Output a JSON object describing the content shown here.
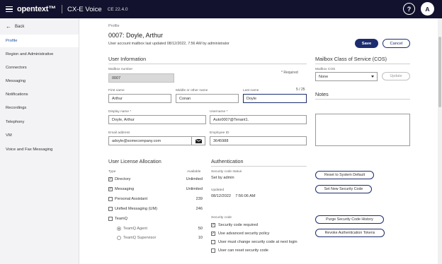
{
  "topbar": {
    "logo": "opentext™",
    "product": "CX-E Voice",
    "version": "CE 22.4.0",
    "help": "?",
    "avatar": "A"
  },
  "sidebar": {
    "back": "Back",
    "items": [
      {
        "label": "Profile",
        "active": true
      },
      {
        "label": "Region and Administrative"
      },
      {
        "label": "Connectors"
      },
      {
        "label": "Messaging"
      },
      {
        "label": "Notifications"
      },
      {
        "label": "Recordings"
      },
      {
        "label": "Telephony"
      },
      {
        "label": "VM"
      },
      {
        "label": "Voice and Fax Messaging"
      }
    ]
  },
  "header": {
    "breadcrumb": "Profile",
    "title": "0007: Doyle, Arthur",
    "subtitle": "User account mailbox last updated 08/12/2022, 7:56 AM by administrator",
    "save": "Save",
    "cancel": "Cancel"
  },
  "user_info": {
    "heading": "User Information",
    "required": "* Required",
    "mailbox_label": "Mailbox number",
    "mailbox_value": "0007",
    "first_name_label": "First name",
    "first_name": "Arthur",
    "middle_label": "Middle or other name",
    "middle_name": "Conan",
    "last_label": "Last name",
    "last_name": "Doyle",
    "last_counter": "5 / 25",
    "display_label": "Display name *",
    "display_name": "Doyle, Arthur",
    "username_label": "Username *",
    "username": "Auto0007@Tenant1.",
    "email_label": "Email address",
    "email": "adoyle@somecompany.com",
    "employee_label": "Employee ID",
    "employee_id": "3645988"
  },
  "cos": {
    "heading": "Mailbox Class of Service (COS)",
    "label": "Mailbox COS",
    "value": "None",
    "update": "Update"
  },
  "notes": {
    "heading": "Notes"
  },
  "license": {
    "heading": "User License Allocation",
    "col_type": "Type",
    "col_available": "Available",
    "rows": [
      {
        "label": "Directory",
        "available": "Unlimited",
        "checked": true
      },
      {
        "label": "Messaging",
        "available": "Unlimited",
        "checked": true
      },
      {
        "label": "Personal Assistant",
        "available": "239",
        "checked": false
      },
      {
        "label": "Unified Messaging (UM)",
        "available": "246",
        "checked": false
      },
      {
        "label": "TeamQ",
        "available": "",
        "checked": false
      }
    ],
    "teamq": [
      {
        "label": "TeamQ Agent",
        "available": "50",
        "selected": true
      },
      {
        "label": "TeamQ Supervisor",
        "available": "10",
        "selected": false
      }
    ]
  },
  "auth": {
    "heading": "Authentication",
    "status_label": "Security code status",
    "status_value": "Set by admin",
    "updated_label": "Updated",
    "updated_value": "08/12/2022    7:56:06 AM",
    "code_label": "Security code",
    "options": [
      {
        "label": "Security code required",
        "checked": true
      },
      {
        "label": "Use advanced security policy",
        "checked": true
      },
      {
        "label": "User must change security code at next login",
        "checked": false
      },
      {
        "label": "User can reset security code",
        "checked": false
      }
    ],
    "reset_default": "Reset to System Default",
    "set_new": "Set New Security Code",
    "purge": "Purge Security Code History",
    "revoke": "Revoke Authentication Tokens"
  }
}
